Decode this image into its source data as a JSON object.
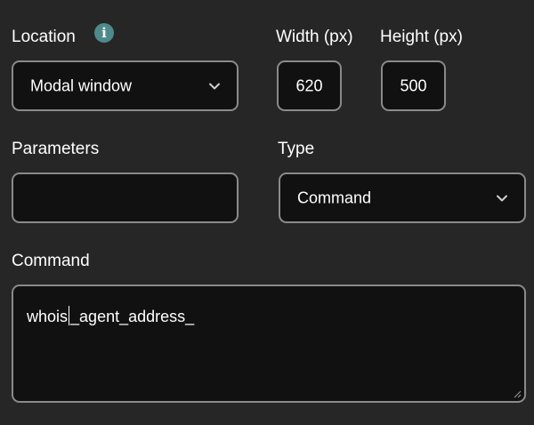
{
  "location": {
    "label": "Location",
    "info_icon": "info-icon",
    "info_icon_glyph": "i",
    "selected": "Modal window"
  },
  "width": {
    "label": "Width (px)",
    "value": "620"
  },
  "height": {
    "label": "Height (px)",
    "value": "500"
  },
  "parameters": {
    "label": "Parameters",
    "value": ""
  },
  "type": {
    "label": "Type",
    "selected": "Command"
  },
  "command": {
    "label": "Command",
    "value_before_caret": "whois",
    "value_after_caret": "_agent_address_"
  },
  "colors": {
    "background": "#262626",
    "field_background": "#111111",
    "field_border": "#8a8a8a",
    "info_icon": "#4f8a8b"
  }
}
